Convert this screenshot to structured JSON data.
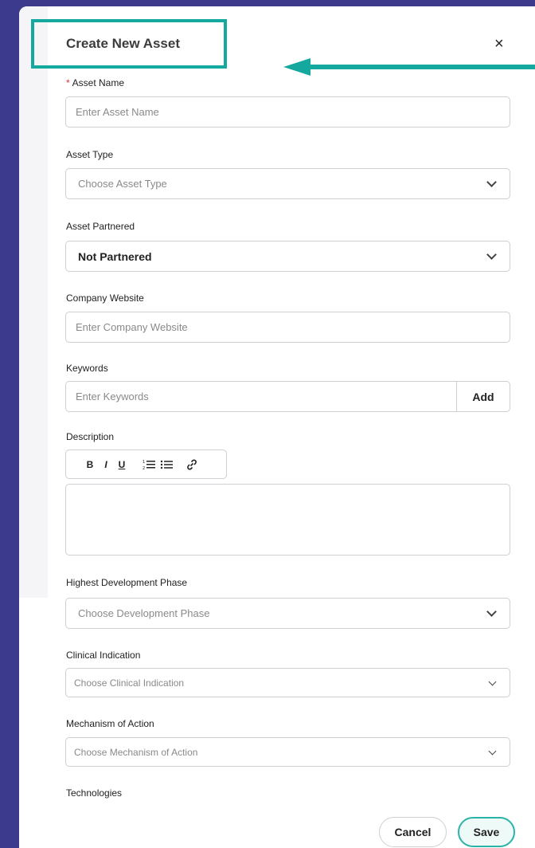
{
  "modal": {
    "title": "Create New Asset",
    "close_glyph": "×"
  },
  "fields": {
    "asset_name": {
      "label": "Asset Name",
      "required_mark": "*",
      "placeholder": "Enter Asset Name"
    },
    "asset_type": {
      "label": "Asset Type",
      "placeholder": "Choose Asset Type"
    },
    "asset_partnered": {
      "label": "Asset Partnered",
      "value": "Not Partnered"
    },
    "company_website": {
      "label": "Company Website",
      "placeholder": "Enter Company Website"
    },
    "keywords": {
      "label": "Keywords",
      "placeholder": "Enter Keywords",
      "add_label": "Add"
    },
    "description": {
      "label": "Description"
    },
    "development_phase": {
      "label": "Highest Development Phase",
      "placeholder": "Choose Development Phase"
    },
    "clinical_indication": {
      "label": "Clinical Indication",
      "placeholder": "Choose Clinical Indication"
    },
    "mechanism_of_action": {
      "label": "Mechanism of Action",
      "placeholder": "Choose Mechanism of Action"
    },
    "technologies": {
      "label": "Technologies"
    }
  },
  "toolbar": {
    "bold": "B",
    "italic": "I",
    "underline": "U",
    "ordered_list": "⋮≡",
    "bullet_list": "☰",
    "link": "🔗"
  },
  "footer": {
    "cancel_label": "Cancel",
    "save_label": "Save"
  },
  "colors": {
    "background": "#3d3a8c",
    "highlight": "#14a89f",
    "required": "#e0303e",
    "save_border": "#2bb3a8"
  }
}
